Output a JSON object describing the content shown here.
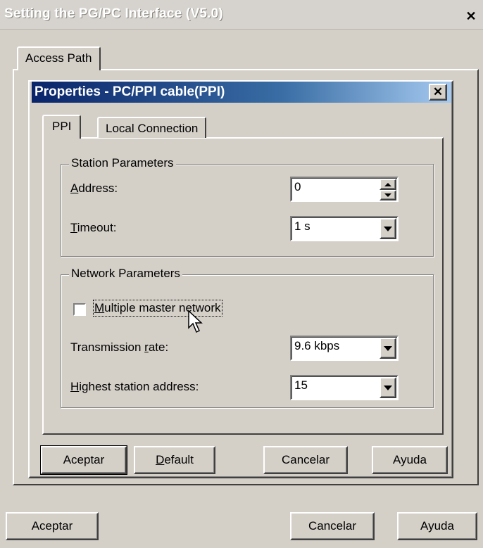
{
  "outer_window": {
    "title": "Setting the PG/PC Interface (V5.0)",
    "close_glyph": "✕",
    "tab_label": "Access Path",
    "buttons": {
      "accept": "Aceptar",
      "cancel": "Cancelar",
      "help": "Ayuda"
    }
  },
  "dialog": {
    "title": "Properties - PC/PPI cable(PPI)",
    "close_glyph": "✕",
    "tabs": [
      {
        "label": "PPI",
        "active": true
      },
      {
        "label": "Local Connection",
        "active": false
      }
    ],
    "station_parameters": {
      "legend": "Station Parameters",
      "address_label_ul": "A",
      "address_label_rest": "ddress:",
      "address_value": "0",
      "timeout_label_ul": "T",
      "timeout_label_rest": "imeout:",
      "timeout_value": "1 s"
    },
    "network_parameters": {
      "legend": "Network Parameters",
      "multimaster_label_ul": "M",
      "multimaster_label_rest": "ultiple master network",
      "multimaster_checked": false,
      "rate_label_pre": "Transmission ",
      "rate_label_ul": "r",
      "rate_label_post": "ate:",
      "rate_value": "9.6 kbps",
      "highest_label_ul": "H",
      "highest_label_rest": "ighest station address:",
      "highest_value": "15"
    },
    "buttons": {
      "accept": "Aceptar",
      "default_ul": "D",
      "default_rest": "efault",
      "cancel": "Cancelar",
      "help": "Ayuda"
    }
  },
  "colors": {
    "face": "#d4d0c8",
    "title_active_start": "#0a246a",
    "title_active_end": "#a6caf0"
  },
  "icons": [
    "close-icon",
    "dropdown-arrow-icon",
    "spin-up-icon",
    "spin-down-icon",
    "mouse-cursor-icon"
  ]
}
